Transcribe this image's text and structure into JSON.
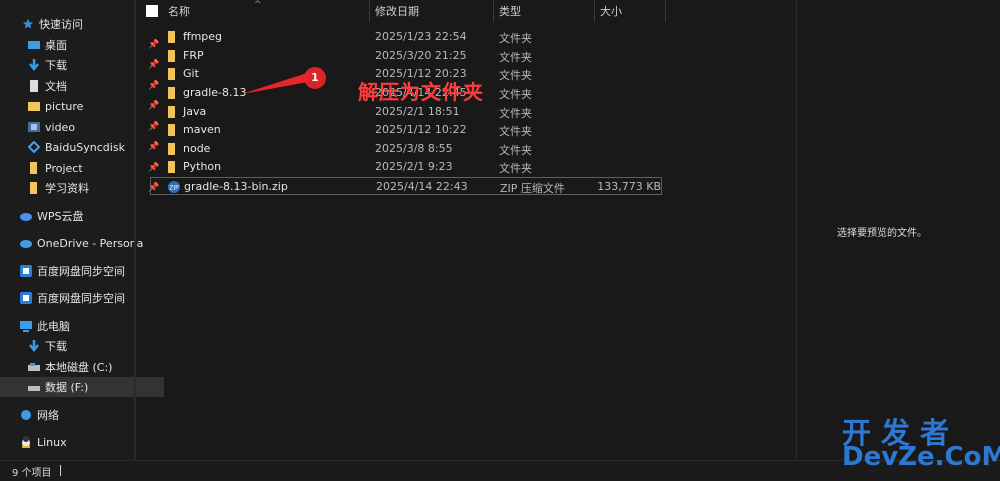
{
  "sidebar": {
    "quick_access": "快速访问",
    "items": [
      {
        "label": "桌面",
        "icon": "desktop-icon",
        "pinned": true
      },
      {
        "label": "下载",
        "icon": "download-icon",
        "pinned": true
      },
      {
        "label": "文档",
        "icon": "document-icon",
        "pinned": true
      },
      {
        "label": "picture",
        "icon": "folder-icon",
        "pinned": true
      },
      {
        "label": "video",
        "icon": "video-folder-icon",
        "pinned": true
      },
      {
        "label": "BaiduSyncdisk",
        "icon": "baidu-sync-icon",
        "pinned": true
      },
      {
        "label": "Project",
        "icon": "folder-icon",
        "pinned": true
      },
      {
        "label": "学习资料",
        "icon": "folder-icon",
        "pinned": true
      }
    ],
    "wps": "WPS云盘",
    "onedrive": "OneDrive - Persona",
    "baidu1": "百度网盘同步空间",
    "baidu2": "百度网盘同步空间",
    "this_pc": "此电脑",
    "pc_items": [
      {
        "label": "下载",
        "icon": "download-icon"
      },
      {
        "label": "本地磁盘 (C:)",
        "icon": "drive-icon"
      },
      {
        "label": "数据 (F:)",
        "icon": "drive-icon",
        "selected": true
      }
    ],
    "network": "网络",
    "linux": "Linux"
  },
  "columns": {
    "name": "名称",
    "date": "修改日期",
    "type": "类型",
    "size": "大小"
  },
  "files": [
    {
      "name": "ffmpeg",
      "date": "2025/1/23 22:54",
      "type": "文件夹",
      "size": "",
      "icon": "folder-icon"
    },
    {
      "name": "FRP",
      "date": "2025/3/20 21:25",
      "type": "文件夹",
      "size": "",
      "icon": "folder-icon"
    },
    {
      "name": "Git",
      "date": "2025/1/12 20:23",
      "type": "文件夹",
      "size": "",
      "icon": "folder-icon"
    },
    {
      "name": "gradle-8.13",
      "date": "2025/4/14 22:45",
      "type": "文件夹",
      "size": "",
      "icon": "folder-icon"
    },
    {
      "name": "Java",
      "date": "2025/2/1 18:51",
      "type": "文件夹",
      "size": "",
      "icon": "folder-icon"
    },
    {
      "name": "maven",
      "date": "2025/1/12 10:22",
      "type": "文件夹",
      "size": "",
      "icon": "folder-icon"
    },
    {
      "name": "node",
      "date": "2025/3/8 8:55",
      "type": "文件夹",
      "size": "",
      "icon": "folder-icon"
    },
    {
      "name": "Python",
      "date": "2025/2/1 9:23",
      "type": "文件夹",
      "size": "",
      "icon": "folder-icon"
    },
    {
      "name": "gradle-8.13-bin.zip",
      "date": "2025/4/14 22:43",
      "type": "ZIP 压缩文件",
      "size": "133,773 KB",
      "icon": "zip-icon"
    }
  ],
  "preview": {
    "text": "选择要预览的文件。"
  },
  "status": {
    "count": "9 个项目"
  },
  "annotation": {
    "number": "1",
    "text": "解压为文件夹"
  },
  "watermark": {
    "line1": "开发者",
    "line2": "DevZe.CoM"
  },
  "colors": {
    "folder": "#f2c55c",
    "annotation": "#e8252b",
    "watermark": "#2d78d2",
    "selection": "#333333"
  }
}
